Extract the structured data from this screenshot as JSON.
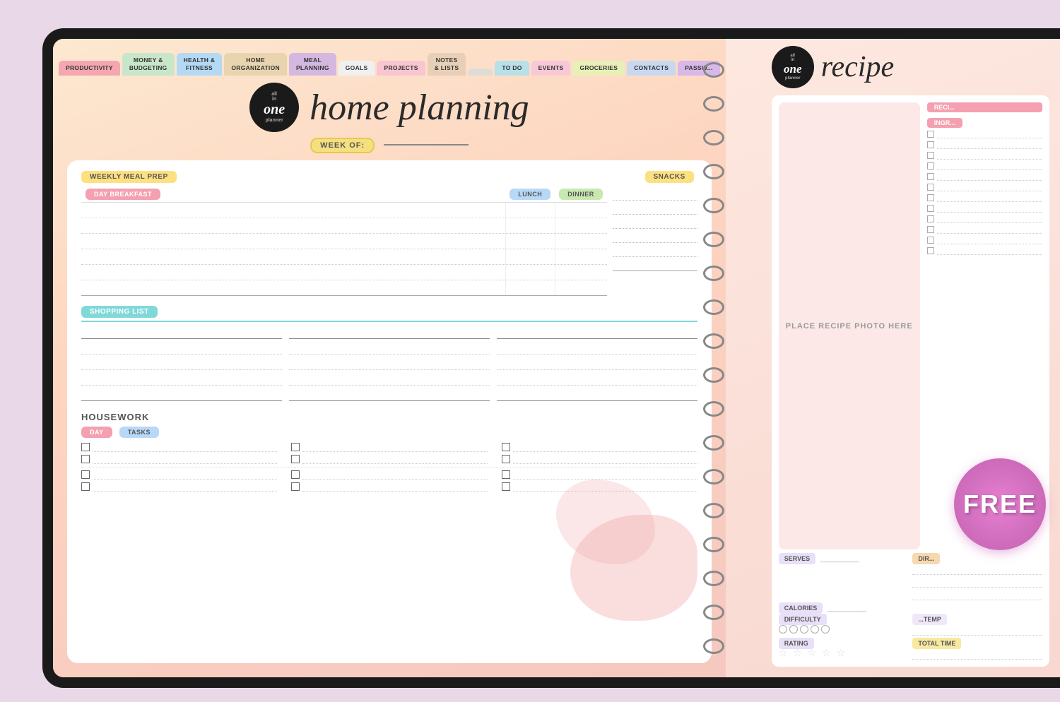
{
  "page": {
    "title": "Home Planning Planner",
    "background_color": "#e8d8e8"
  },
  "tabs": [
    {
      "id": "productivity",
      "label": "PRODUCTIVITY",
      "color": "#f4a7b0"
    },
    {
      "id": "money",
      "label": "MONEY &\nBUDGETING",
      "color": "#c8e6c9"
    },
    {
      "id": "health",
      "label": "HEALTH &\nFITNESS",
      "color": "#b3d9f5"
    },
    {
      "id": "home",
      "label": "HOME\nORGANIZATION",
      "color": "#e8d5b0"
    },
    {
      "id": "meal",
      "label": "MEAL\nPLANNING",
      "color": "#d4b8e0"
    },
    {
      "id": "goals",
      "label": "GOALS",
      "color": "#f5f5f5"
    },
    {
      "id": "projects",
      "label": "PROJECTS",
      "color": "#f8c5d0"
    },
    {
      "id": "notes",
      "label": "NOTES\n& LISTS",
      "color": "#e8d0b8"
    },
    {
      "id": "spacer",
      "label": "",
      "color": "#e8e0d8"
    },
    {
      "id": "todo",
      "label": "TO DO",
      "color": "#b8e0e8"
    },
    {
      "id": "events",
      "label": "EVENTS",
      "color": "#f8c8d8"
    },
    {
      "id": "groceries",
      "label": "GROCERIES",
      "color": "#e8f0b8"
    },
    {
      "id": "contacts",
      "label": "CONTACTS",
      "color": "#c8d8f0"
    },
    {
      "id": "password",
      "label": "PASSW...",
      "color": "#d8b8e8"
    }
  ],
  "planner": {
    "title": "home planning",
    "logo": {
      "all": "all",
      "in": "in",
      "one": "one",
      "planner": "planner"
    },
    "week_of_label": "WEEK OF:",
    "sections": {
      "meal_prep": {
        "title": "WEEKLY MEAL PREP",
        "columns": [
          "day",
          "breakfast",
          "lunch",
          "dinner"
        ],
        "snacks_title": "SNACKS"
      },
      "shopping_list": {
        "title": "SHOPPING LIST"
      },
      "housework": {
        "title": "HOUSEWORK",
        "day_label": "day",
        "tasks_label": "tasks"
      }
    }
  },
  "recipe_page": {
    "title": "recipe",
    "photo_placeholder": "PLACE RECIPE PHOTO HERE",
    "sections": {
      "recipe_name": "RECI...",
      "ingredients": "INGR...",
      "serves": "SERVES",
      "calories": "CALORIES",
      "difficulty": "DIFFICULTY",
      "temp_label": "...TEMP",
      "rating": "RATING",
      "total_time": "TOTAL TIME",
      "directions": "DIR..."
    },
    "free_badge": "FREE"
  }
}
